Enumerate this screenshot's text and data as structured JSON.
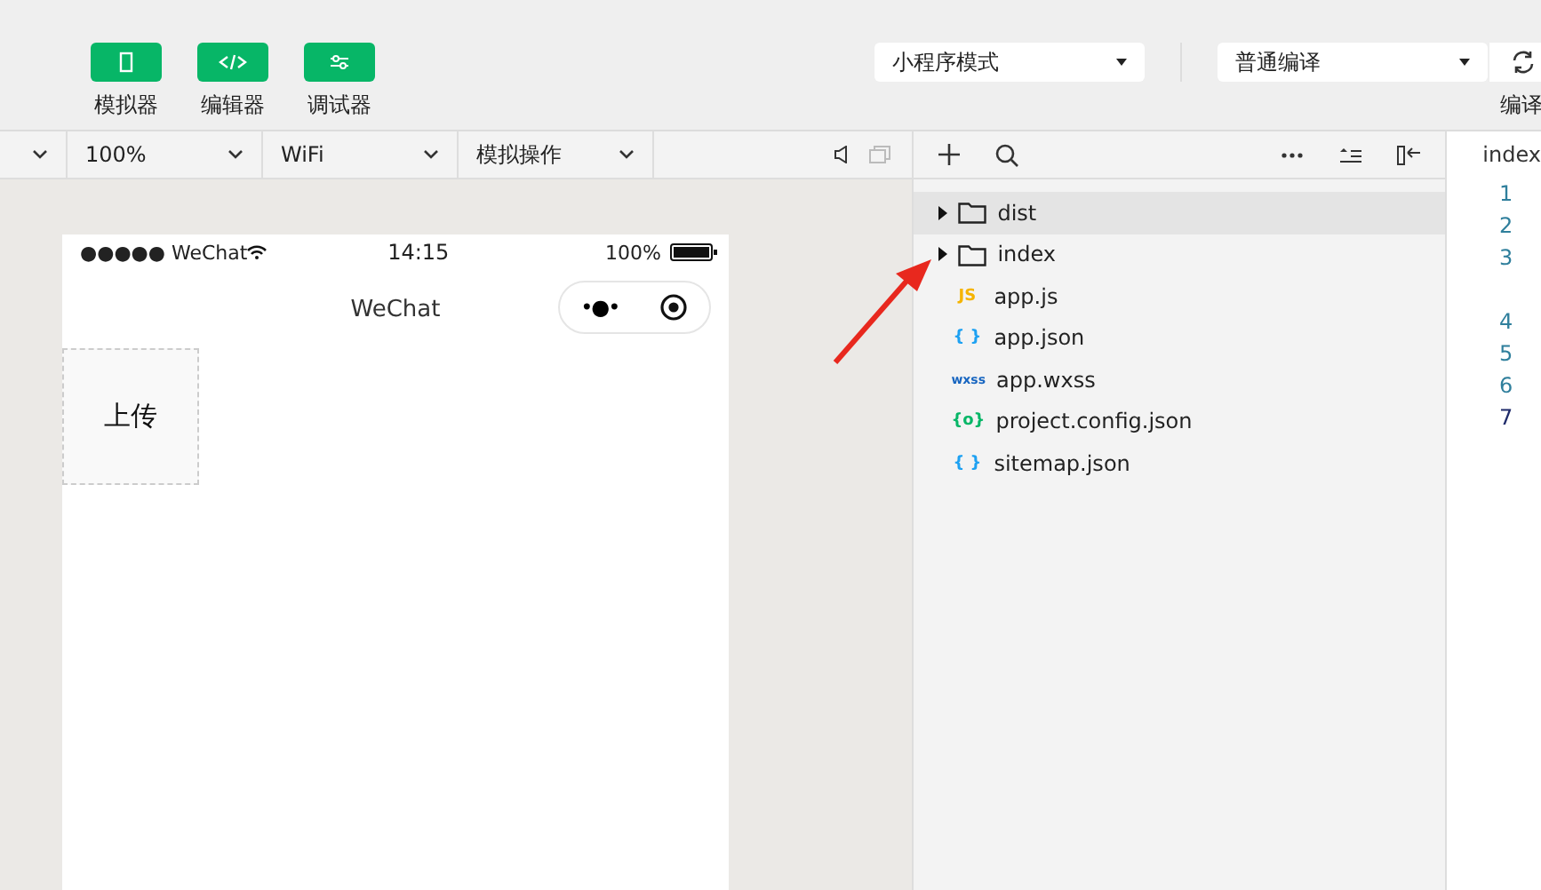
{
  "toolbar": {
    "buttons": [
      {
        "label": "模拟器",
        "kind": "phone"
      },
      {
        "label": "编辑器",
        "kind": "code"
      },
      {
        "label": "调试器",
        "kind": "sliders"
      }
    ],
    "mode_select": {
      "value": "小程序模式"
    },
    "compile_select": {
      "value": "普通编译"
    },
    "compile_button": {
      "label": "编译"
    }
  },
  "sim_bar": {
    "selects": [
      {
        "value": "100%"
      },
      {
        "value": "WiFi"
      },
      {
        "value": "模拟操作"
      }
    ]
  },
  "phone": {
    "carrier": "●●●●● WeChat",
    "time": "14:15",
    "battery": "100%",
    "title": "WeChat",
    "capsule_dots": "•●•",
    "upload_label": "上传"
  },
  "files": [
    {
      "name": "dist",
      "kind": "folder",
      "expanded": false,
      "selected": true
    },
    {
      "name": "index",
      "kind": "folder",
      "expanded": false,
      "selected": false
    },
    {
      "name": "app.js",
      "kind": "js",
      "icon_text": "JS",
      "selected": false
    },
    {
      "name": "app.json",
      "kind": "json",
      "icon_text": "{ }",
      "selected": false
    },
    {
      "name": "app.wxss",
      "kind": "wxss",
      "icon_text": "wxss",
      "selected": false
    },
    {
      "name": "project.config.json",
      "kind": "config",
      "icon_text": "{o}",
      "selected": false
    },
    {
      "name": "sitemap.json",
      "kind": "json",
      "icon_text": "{ }",
      "selected": false
    }
  ],
  "editor": {
    "tab": "index",
    "lines": [
      {
        "number": "1",
        "current": false,
        "wrapped": false
      },
      {
        "number": "2",
        "current": false,
        "wrapped": false
      },
      {
        "number": "3",
        "current": false,
        "wrapped": true
      },
      {
        "number": "4",
        "current": false,
        "wrapped": false
      },
      {
        "number": "5",
        "current": false,
        "wrapped": false
      },
      {
        "number": "6",
        "current": false,
        "wrapped": false
      },
      {
        "number": "7",
        "current": true,
        "wrapped": false
      }
    ]
  }
}
